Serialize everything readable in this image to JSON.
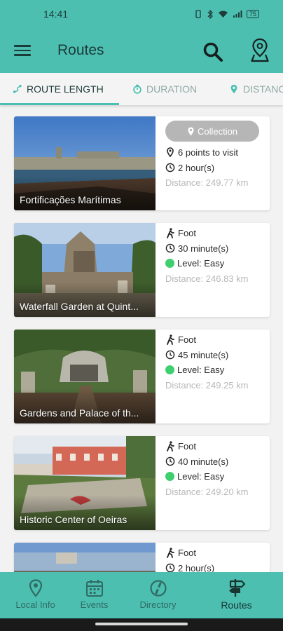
{
  "status": {
    "time": "14:41",
    "battery": "75"
  },
  "app_bar": {
    "title": "Routes"
  },
  "tabs": [
    {
      "label": "ROUTE LENGTH",
      "active": true
    },
    {
      "label": "DURATION",
      "active": false
    },
    {
      "label": "DISTANC",
      "active": false
    }
  ],
  "routes": [
    {
      "title": "Fortificações Marítimas",
      "badge": "Collection",
      "points": "6 points to visit",
      "duration": "2 hour(s)",
      "distance": "Distance: 249.77 km"
    },
    {
      "title": "Waterfall Garden at Quint...",
      "mode": "Foot",
      "duration": "30 minute(s)",
      "level": "Level: Easy",
      "distance": "Distance: 246.83 km"
    },
    {
      "title": "Gardens and Palace of th...",
      "mode": "Foot",
      "duration": "45 minute(s)",
      "level": "Level: Easy",
      "distance": "Distance: 249.25 km"
    },
    {
      "title": "Historic Center of Oeiras",
      "mode": "Foot",
      "duration": "40 minute(s)",
      "level": "Level: Easy",
      "distance": "Distance: 249.20 km"
    },
    {
      "mode": "Foot",
      "duration": "2 hour(s)"
    }
  ],
  "bottom_nav": [
    {
      "label": "Local Info",
      "icon": "map-pin-icon"
    },
    {
      "label": "Events",
      "icon": "calendar-icon"
    },
    {
      "label": "Directory",
      "icon": "compass-icon"
    },
    {
      "label": "Routes",
      "icon": "signpost-icon",
      "active": true
    }
  ],
  "colors": {
    "primary": "#4cbfb1",
    "level_easy": "#3fcf6f",
    "badge": "#b6b6b6"
  }
}
